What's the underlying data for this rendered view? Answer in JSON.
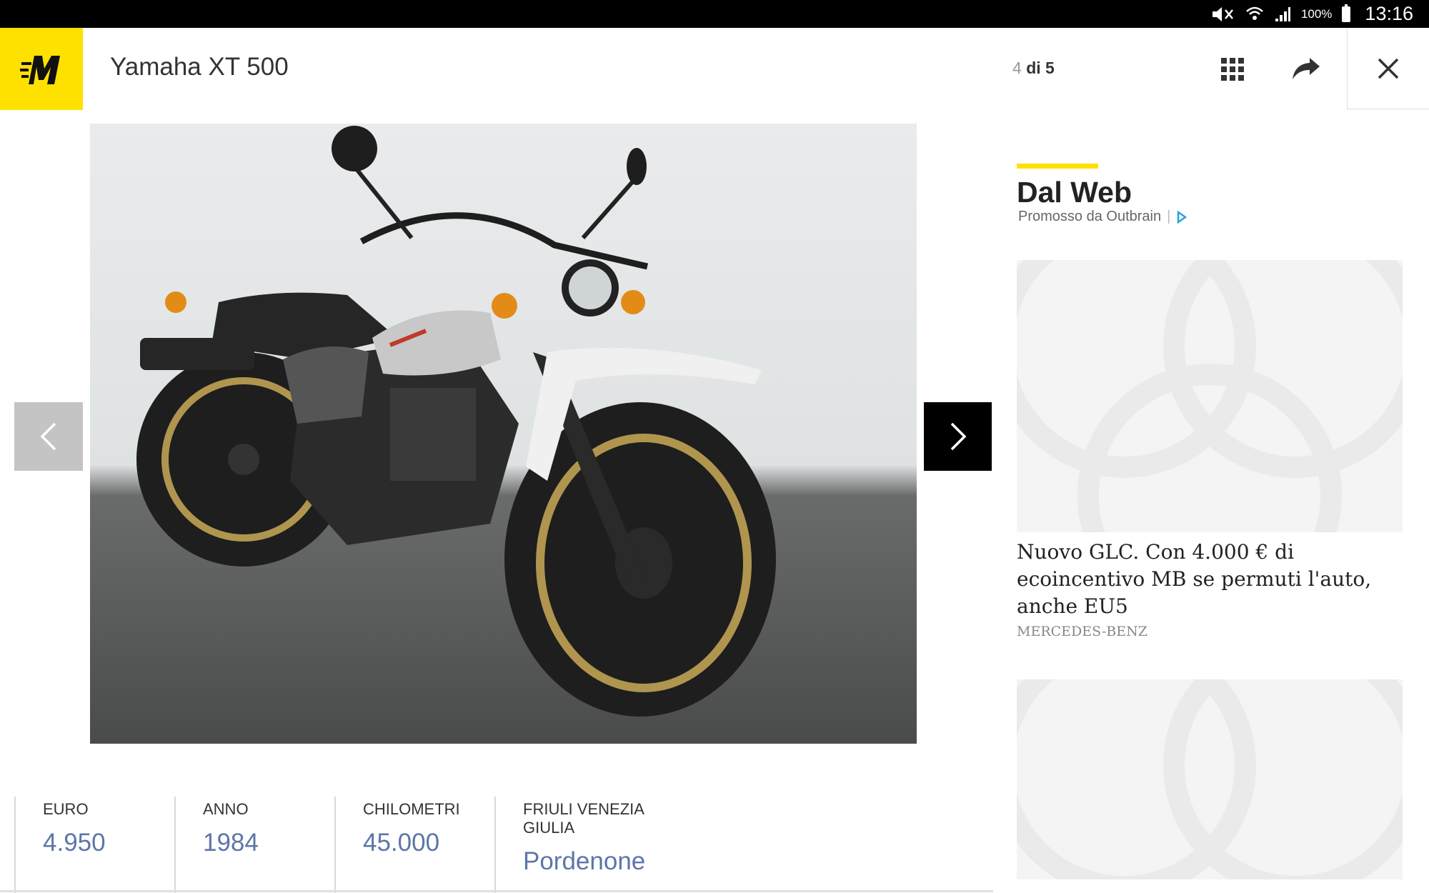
{
  "status_bar": {
    "battery_text": "100%",
    "time": "13:16"
  },
  "header": {
    "title": "Yamaha XT 500",
    "counter_current": "4",
    "counter_rest": "di 5"
  },
  "icons": {
    "logo": "m-logo-icon",
    "grid": "grid-icon",
    "share": "share-icon",
    "close": "close-icon",
    "prev": "chevron-left-icon",
    "next": "chevron-right-icon",
    "adchoices": "adchoices-icon"
  },
  "colors": {
    "brand_yellow": "#ffe100",
    "value_blue": "#5d76a8"
  },
  "specs": [
    {
      "label": "EURO",
      "value": "4.950"
    },
    {
      "label": "ANNO",
      "value": "1984"
    },
    {
      "label": "CHILOMETRI",
      "value": "45.000"
    },
    {
      "label": "FRIULI VENEZIA GIULIA",
      "value": "Pordenone"
    }
  ],
  "sidebar": {
    "heading": "Dal Web",
    "promo_text": "Promosso da Outbrain",
    "promo_sep": "|",
    "ads": [
      {
        "title": "Nuovo GLC. Con 4.000 € di ecoincentivo MB se permuti l'auto, anche EU5",
        "source": "MERCEDES-BENZ"
      }
    ]
  }
}
